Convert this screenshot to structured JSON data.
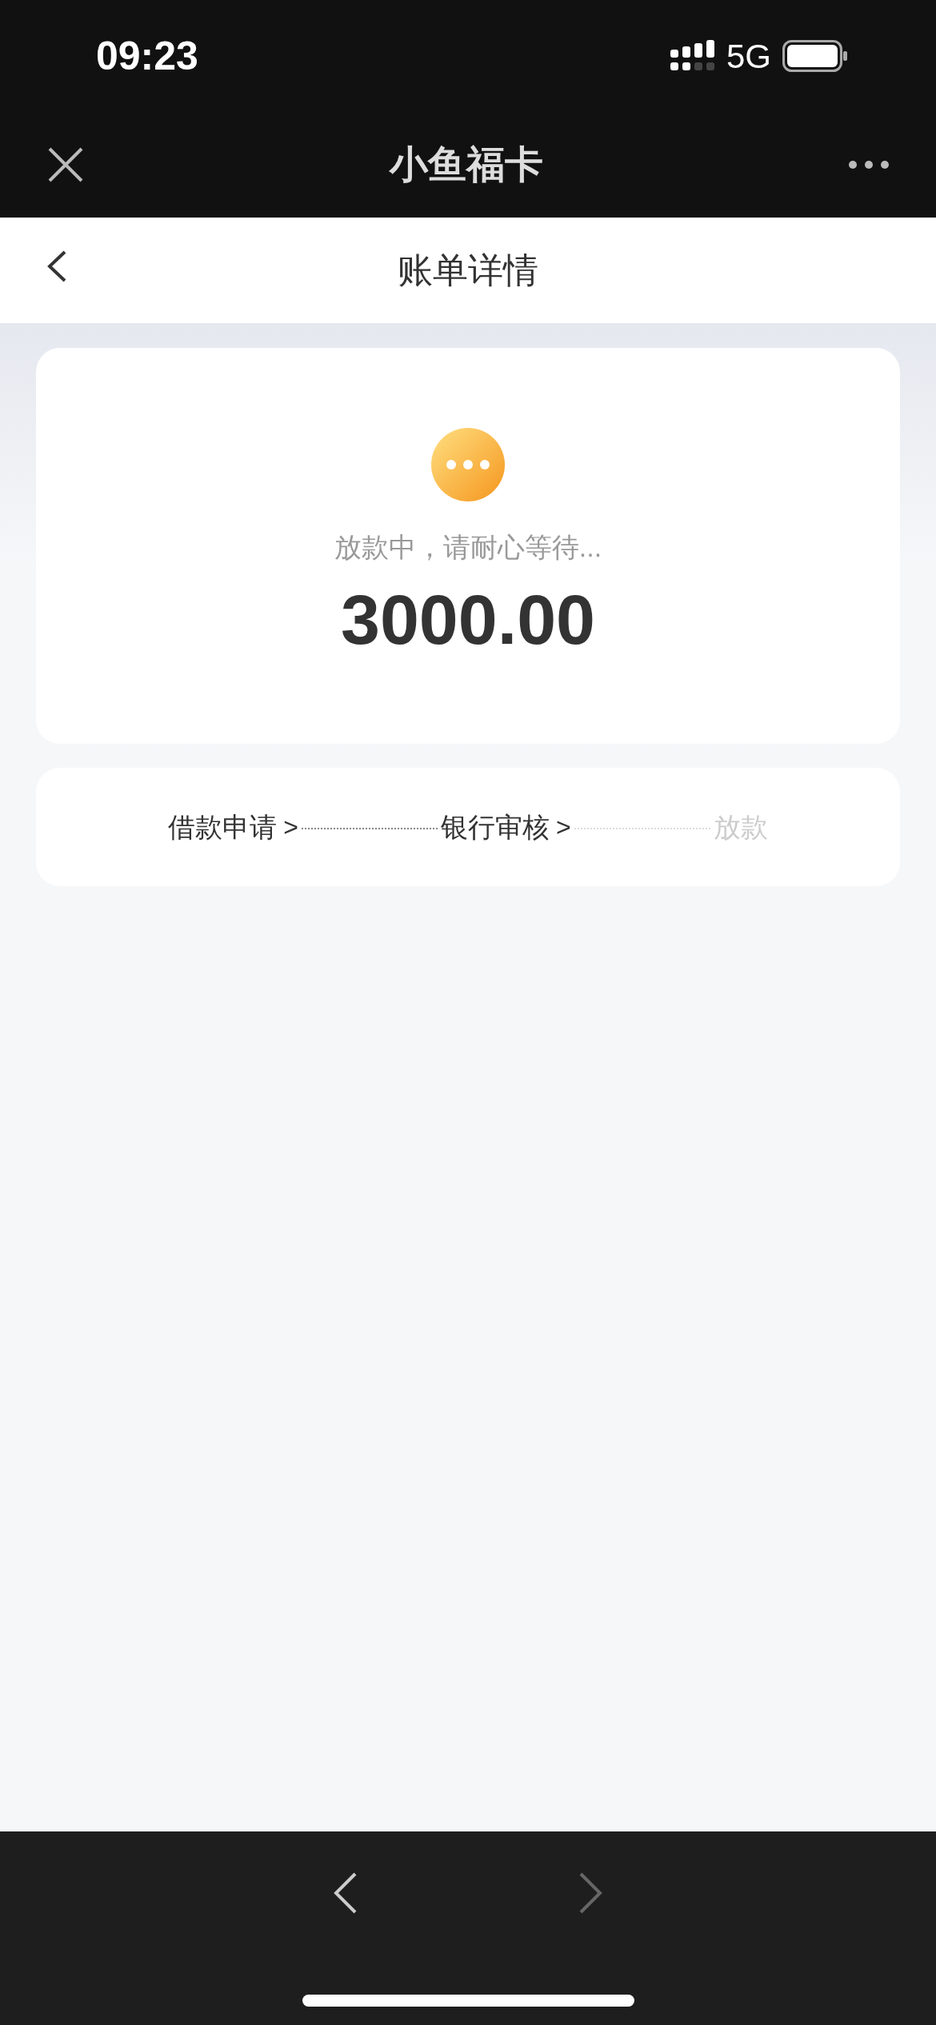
{
  "status_bar": {
    "time": "09:23",
    "network": "5G"
  },
  "mini_program_bar": {
    "title": "小鱼福卡"
  },
  "page_header": {
    "title": "账单详情"
  },
  "status_card": {
    "message": "放款中，请耐心等待...",
    "amount": "3000.00"
  },
  "steps": [
    {
      "label": "借款申请",
      "arrow": ">",
      "done": true
    },
    {
      "label": "银行审核",
      "arrow": ">",
      "done": true
    },
    {
      "label": "放款",
      "done": false
    }
  ],
  "browser_nav": [
    {
      "kind": "back",
      "disabled": false
    },
    {
      "kind": "forward",
      "disabled": true
    }
  ]
}
